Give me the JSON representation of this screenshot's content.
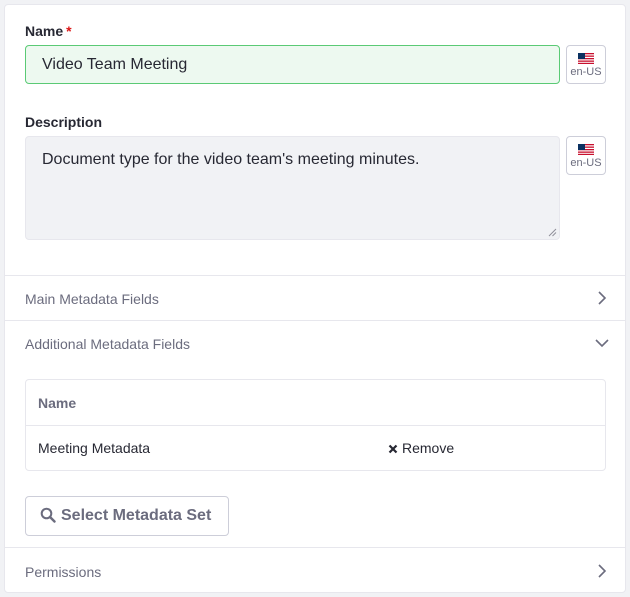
{
  "name_field": {
    "label": "Name",
    "required_marker": "*",
    "value": "Video Team Meeting",
    "locale": "en-US"
  },
  "description_field": {
    "label": "Description",
    "value": "Document type for the video team's meeting minutes.",
    "locale": "en-US"
  },
  "sections": {
    "main_metadata": {
      "title": "Main Metadata Fields",
      "state": "collapsed"
    },
    "additional_metadata": {
      "title": "Additional Metadata Fields",
      "state": "expanded"
    },
    "permissions": {
      "title": "Permissions",
      "state": "collapsed"
    }
  },
  "metadata_table": {
    "header_name": "Name",
    "rows": [
      {
        "name": "Meeting Metadata",
        "action_label": "Remove"
      }
    ]
  },
  "select_button": {
    "label": "Select Metadata Set"
  },
  "icons": {
    "flag": "us-flag-icon",
    "collapsed": "chevron-right-icon",
    "expanded": "chevron-down-icon",
    "remove": "times-icon",
    "search": "search-icon"
  },
  "colors": {
    "valid_border": "#5aca75",
    "valid_bg": "#edf9f0",
    "required": "#da1414",
    "muted_text": "#6b6c7e"
  }
}
